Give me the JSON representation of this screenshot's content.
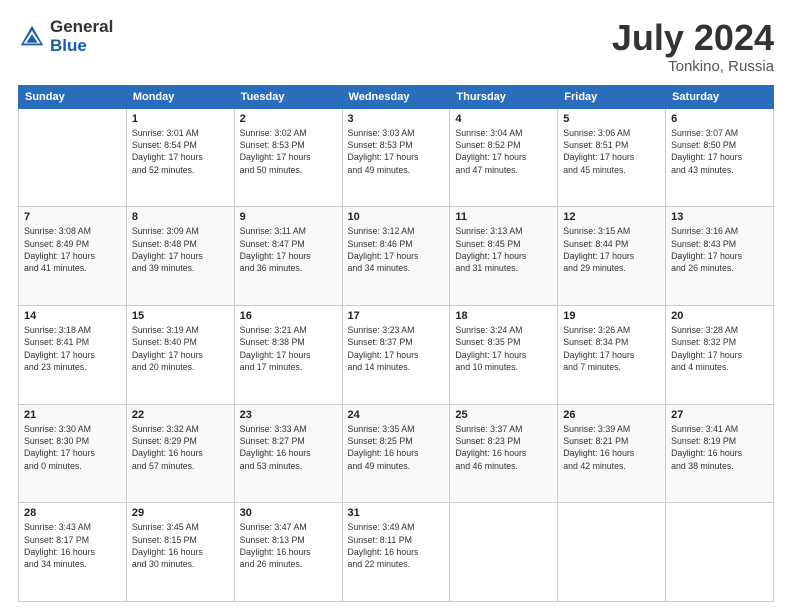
{
  "header": {
    "logo_general": "General",
    "logo_blue": "Blue",
    "title": "July 2024",
    "location": "Tonkino, Russia"
  },
  "days_of_week": [
    "Sunday",
    "Monday",
    "Tuesday",
    "Wednesday",
    "Thursday",
    "Friday",
    "Saturday"
  ],
  "weeks": [
    [
      {
        "day": "",
        "sunrise": "",
        "sunset": "",
        "daylight": ""
      },
      {
        "day": "1",
        "sunrise": "Sunrise: 3:01 AM",
        "sunset": "Sunset: 8:54 PM",
        "daylight": "Daylight: 17 hours and 52 minutes."
      },
      {
        "day": "2",
        "sunrise": "Sunrise: 3:02 AM",
        "sunset": "Sunset: 8:53 PM",
        "daylight": "Daylight: 17 hours and 50 minutes."
      },
      {
        "day": "3",
        "sunrise": "Sunrise: 3:03 AM",
        "sunset": "Sunset: 8:53 PM",
        "daylight": "Daylight: 17 hours and 49 minutes."
      },
      {
        "day": "4",
        "sunrise": "Sunrise: 3:04 AM",
        "sunset": "Sunset: 8:52 PM",
        "daylight": "Daylight: 17 hours and 47 minutes."
      },
      {
        "day": "5",
        "sunrise": "Sunrise: 3:06 AM",
        "sunset": "Sunset: 8:51 PM",
        "daylight": "Daylight: 17 hours and 45 minutes."
      },
      {
        "day": "6",
        "sunrise": "Sunrise: 3:07 AM",
        "sunset": "Sunset: 8:50 PM",
        "daylight": "Daylight: 17 hours and 43 minutes."
      }
    ],
    [
      {
        "day": "7",
        "sunrise": "Sunrise: 3:08 AM",
        "sunset": "Sunset: 8:49 PM",
        "daylight": "Daylight: 17 hours and 41 minutes."
      },
      {
        "day": "8",
        "sunrise": "Sunrise: 3:09 AM",
        "sunset": "Sunset: 8:48 PM",
        "daylight": "Daylight: 17 hours and 39 minutes."
      },
      {
        "day": "9",
        "sunrise": "Sunrise: 3:11 AM",
        "sunset": "Sunset: 8:47 PM",
        "daylight": "Daylight: 17 hours and 36 minutes."
      },
      {
        "day": "10",
        "sunrise": "Sunrise: 3:12 AM",
        "sunset": "Sunset: 8:46 PM",
        "daylight": "Daylight: 17 hours and 34 minutes."
      },
      {
        "day": "11",
        "sunrise": "Sunrise: 3:13 AM",
        "sunset": "Sunset: 8:45 PM",
        "daylight": "Daylight: 17 hours and 31 minutes."
      },
      {
        "day": "12",
        "sunrise": "Sunrise: 3:15 AM",
        "sunset": "Sunset: 8:44 PM",
        "daylight": "Daylight: 17 hours and 29 minutes."
      },
      {
        "day": "13",
        "sunrise": "Sunrise: 3:16 AM",
        "sunset": "Sunset: 8:43 PM",
        "daylight": "Daylight: 17 hours and 26 minutes."
      }
    ],
    [
      {
        "day": "14",
        "sunrise": "Sunrise: 3:18 AM",
        "sunset": "Sunset: 8:41 PM",
        "daylight": "Daylight: 17 hours and 23 minutes."
      },
      {
        "day": "15",
        "sunrise": "Sunrise: 3:19 AM",
        "sunset": "Sunset: 8:40 PM",
        "daylight": "Daylight: 17 hours and 20 minutes."
      },
      {
        "day": "16",
        "sunrise": "Sunrise: 3:21 AM",
        "sunset": "Sunset: 8:38 PM",
        "daylight": "Daylight: 17 hours and 17 minutes."
      },
      {
        "day": "17",
        "sunrise": "Sunrise: 3:23 AM",
        "sunset": "Sunset: 8:37 PM",
        "daylight": "Daylight: 17 hours and 14 minutes."
      },
      {
        "day": "18",
        "sunrise": "Sunrise: 3:24 AM",
        "sunset": "Sunset: 8:35 PM",
        "daylight": "Daylight: 17 hours and 10 minutes."
      },
      {
        "day": "19",
        "sunrise": "Sunrise: 3:26 AM",
        "sunset": "Sunset: 8:34 PM",
        "daylight": "Daylight: 17 hours and 7 minutes."
      },
      {
        "day": "20",
        "sunrise": "Sunrise: 3:28 AM",
        "sunset": "Sunset: 8:32 PM",
        "daylight": "Daylight: 17 hours and 4 minutes."
      }
    ],
    [
      {
        "day": "21",
        "sunrise": "Sunrise: 3:30 AM",
        "sunset": "Sunset: 8:30 PM",
        "daylight": "Daylight: 17 hours and 0 minutes."
      },
      {
        "day": "22",
        "sunrise": "Sunrise: 3:32 AM",
        "sunset": "Sunset: 8:29 PM",
        "daylight": "Daylight: 16 hours and 57 minutes."
      },
      {
        "day": "23",
        "sunrise": "Sunrise: 3:33 AM",
        "sunset": "Sunset: 8:27 PM",
        "daylight": "Daylight: 16 hours and 53 minutes."
      },
      {
        "day": "24",
        "sunrise": "Sunrise: 3:35 AM",
        "sunset": "Sunset: 8:25 PM",
        "daylight": "Daylight: 16 hours and 49 minutes."
      },
      {
        "day": "25",
        "sunrise": "Sunrise: 3:37 AM",
        "sunset": "Sunset: 8:23 PM",
        "daylight": "Daylight: 16 hours and 46 minutes."
      },
      {
        "day": "26",
        "sunrise": "Sunrise: 3:39 AM",
        "sunset": "Sunset: 8:21 PM",
        "daylight": "Daylight: 16 hours and 42 minutes."
      },
      {
        "day": "27",
        "sunrise": "Sunrise: 3:41 AM",
        "sunset": "Sunset: 8:19 PM",
        "daylight": "Daylight: 16 hours and 38 minutes."
      }
    ],
    [
      {
        "day": "28",
        "sunrise": "Sunrise: 3:43 AM",
        "sunset": "Sunset: 8:17 PM",
        "daylight": "Daylight: 16 hours and 34 minutes."
      },
      {
        "day": "29",
        "sunrise": "Sunrise: 3:45 AM",
        "sunset": "Sunset: 8:15 PM",
        "daylight": "Daylight: 16 hours and 30 minutes."
      },
      {
        "day": "30",
        "sunrise": "Sunrise: 3:47 AM",
        "sunset": "Sunset: 8:13 PM",
        "daylight": "Daylight: 16 hours and 26 minutes."
      },
      {
        "day": "31",
        "sunrise": "Sunrise: 3:49 AM",
        "sunset": "Sunset: 8:11 PM",
        "daylight": "Daylight: 16 hours and 22 minutes."
      },
      {
        "day": "",
        "sunrise": "",
        "sunset": "",
        "daylight": ""
      },
      {
        "day": "",
        "sunrise": "",
        "sunset": "",
        "daylight": ""
      },
      {
        "day": "",
        "sunrise": "",
        "sunset": "",
        "daylight": ""
      }
    ]
  ]
}
